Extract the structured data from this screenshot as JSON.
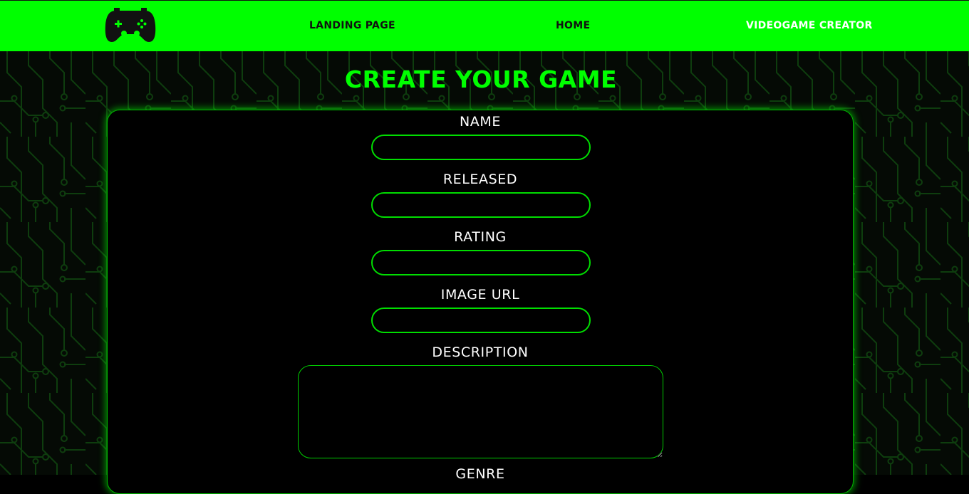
{
  "navbar": {
    "logo_icon": "gamepad-icon",
    "links": [
      {
        "label": "LANDING PAGE"
      },
      {
        "label": "HOME"
      },
      {
        "label": "VIDEOGAME CREATOR",
        "active": true
      }
    ]
  },
  "page": {
    "title": "CREATE YOUR GAME"
  },
  "form": {
    "fields": [
      {
        "label": "NAME",
        "value": ""
      },
      {
        "label": "RELEASED",
        "value": ""
      },
      {
        "label": "RATING",
        "value": ""
      },
      {
        "label": "IMAGE URL",
        "value": ""
      },
      {
        "label": "DESCRIPTION",
        "value": ""
      },
      {
        "label": "GENRE"
      }
    ]
  },
  "colors": {
    "accent": "#00ff00",
    "background": "#000000",
    "text": "#ffffff",
    "circuit": "#0d3a0d"
  }
}
